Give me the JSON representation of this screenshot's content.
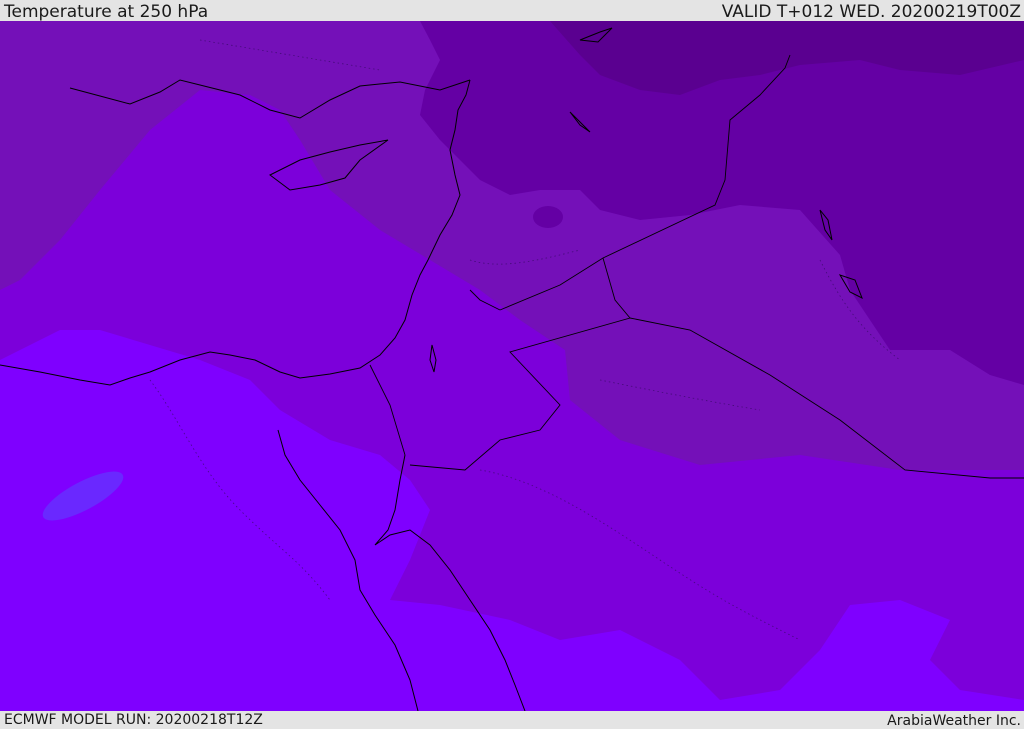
{
  "header": {
    "title": "Temperature at 250 hPa",
    "valid": "VALID T+012 WED. 20200219T00Z"
  },
  "footer": {
    "model_run": "ECMWF MODEL RUN: 20200218T12Z",
    "credit": "ArabiaWeather Inc."
  },
  "map": {
    "colors": {
      "coldest": "#5a0090",
      "colder": "#6400a4",
      "cool": "#7410b8",
      "mid": "#7c00da",
      "warm": "#7f00ff",
      "warmest_patch": "#6a28ff",
      "coast": "#000000"
    }
  }
}
